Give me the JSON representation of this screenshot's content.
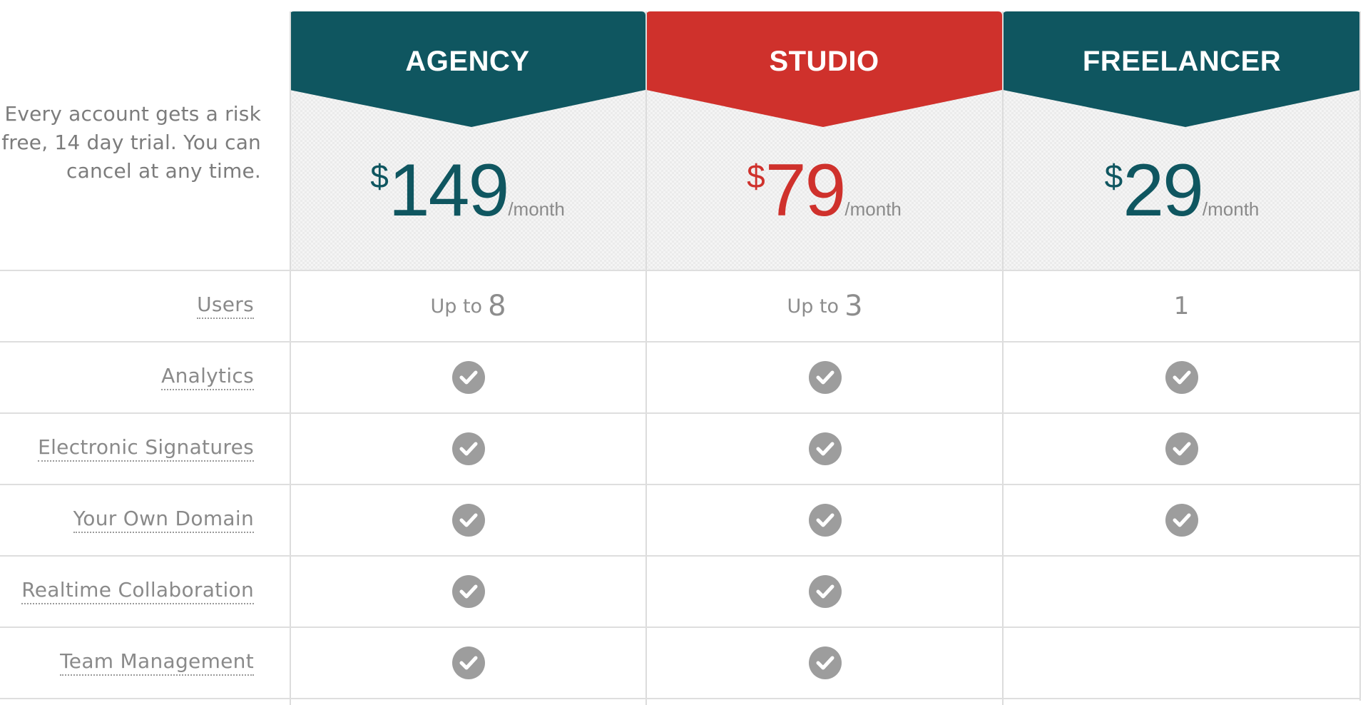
{
  "intro": {
    "line1": "Every account gets a risk",
    "line2": "free, 14 day trial. You can",
    "line3": "cancel at any time."
  },
  "colors": {
    "teal": "#0f5660",
    "red": "#cf312c",
    "check": "#9d9d9d",
    "muted_text": "#8a8a8a"
  },
  "plans": [
    {
      "name": "AGENCY",
      "currency": "$",
      "amount": "149",
      "period": "/month",
      "color": "teal"
    },
    {
      "name": "STUDIO",
      "currency": "$",
      "amount": "79",
      "period": "/month",
      "color": "red"
    },
    {
      "name": "FREELANCER",
      "currency": "$",
      "amount": "29",
      "period": "/month",
      "color": "teal"
    }
  ],
  "features": {
    "users": {
      "label": "Users",
      "agency_prefix": "Up to",
      "agency_value": "8",
      "studio_prefix": "Up to",
      "studio_value": "3",
      "freelancer_value": "1"
    },
    "rows": [
      {
        "label": "Analytics",
        "agency": true,
        "studio": true,
        "freelancer": true
      },
      {
        "label": "Electronic Signatures",
        "agency": true,
        "studio": true,
        "freelancer": true
      },
      {
        "label": "Your Own Domain",
        "agency": true,
        "studio": true,
        "freelancer": true
      },
      {
        "label": "Realtime Collaboration",
        "agency": true,
        "studio": true,
        "freelancer": false
      },
      {
        "label": "Team Management",
        "agency": true,
        "studio": true,
        "freelancer": false
      }
    ],
    "check_icon": "checkmark-circle-icon"
  }
}
